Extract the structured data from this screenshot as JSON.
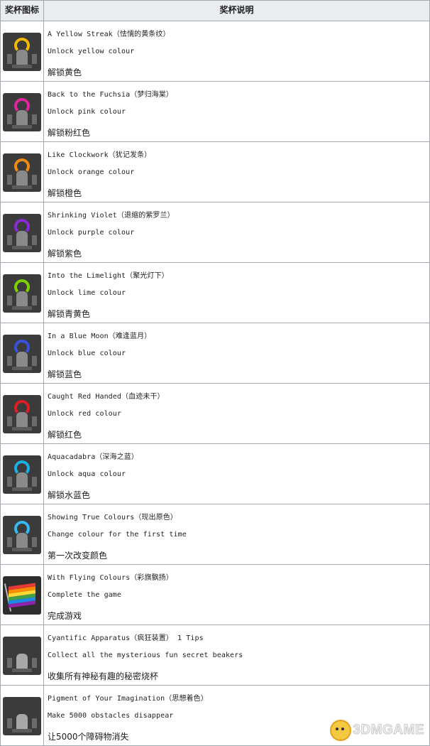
{
  "header": {
    "col_icon": "奖杯图标",
    "col_desc": "奖杯说明"
  },
  "rows": [
    {
      "name": "A Yellow Streak（怯懦的黄条纹）",
      "desc": "Unlock yellow colour",
      "cn": "解锁黄色",
      "color": "#f5b800",
      "icon": "yellow-trophy-icon"
    },
    {
      "name": "Back to the Fuchsia（梦归海棠）",
      "desc": "Unlock pink colour",
      "cn": "解锁粉红色",
      "color": "#e0289c",
      "icon": "pink-trophy-icon"
    },
    {
      "name": "Like Clockwork（犹记发条）",
      "desc": "Unlock orange colour",
      "cn": "解锁橙色",
      "color": "#f08a10",
      "icon": "orange-trophy-icon"
    },
    {
      "name": "Shrinking Violet（退缩的紫罗兰）",
      "desc": "Unlock purple colour",
      "cn": "解锁紫色",
      "color": "#8a2ad8",
      "icon": "purple-trophy-icon"
    },
    {
      "name": "Into the Limelight（聚光灯下）",
      "desc": "Unlock lime colour",
      "cn": "解锁青黄色",
      "color": "#7ed000",
      "icon": "lime-trophy-icon"
    },
    {
      "name": "In a Blue Moon（难逢蓝月）",
      "desc": "Unlock blue colour",
      "cn": "解锁蓝色",
      "color": "#3a50e0",
      "icon": "blue-trophy-icon"
    },
    {
      "name": "Caught Red Handed（血迹未干）",
      "desc": "Unlock red colour",
      "cn": "解锁红色",
      "color": "#e01c24",
      "icon": "red-trophy-icon"
    },
    {
      "name": "Aquacadabra（深海之蓝）",
      "desc": "Unlock aqua colour",
      "cn": "解锁水蓝色",
      "color": "#1ab0e6",
      "icon": "aqua-trophy-icon"
    },
    {
      "name": "Showing True Colours（现出原色）",
      "desc": "Change colour for the first time",
      "cn": "第一次改变颜色",
      "color": "#38b8f0",
      "icon": "true-colours-trophy-icon"
    },
    {
      "name": "With Flying Colours（彩旗飘扬）",
      "desc": "Complete the game",
      "cn": "完成游戏",
      "color": "#ffffff",
      "icon": "rainbow-flag-icon"
    },
    {
      "name": "Cyantific Apparatus（疯狂装置） 1 Tips",
      "desc": "Collect all the mysterious fun secret beakers",
      "cn": "收集所有神秘有趣的秘密烧杯",
      "color": "#bdbdbd",
      "icon": "apparatus-trophy-icon"
    },
    {
      "name": "Pigment of Your Imagination（思想着色）",
      "desc": "Make 5000 obstacles disappear",
      "cn": "让5000个障碍物消失",
      "color": "#9a9a9a",
      "icon": "imagination-trophy-icon"
    }
  ],
  "watermark": {
    "text": "3DMGAME",
    "icon": "mascot-logo-icon"
  }
}
